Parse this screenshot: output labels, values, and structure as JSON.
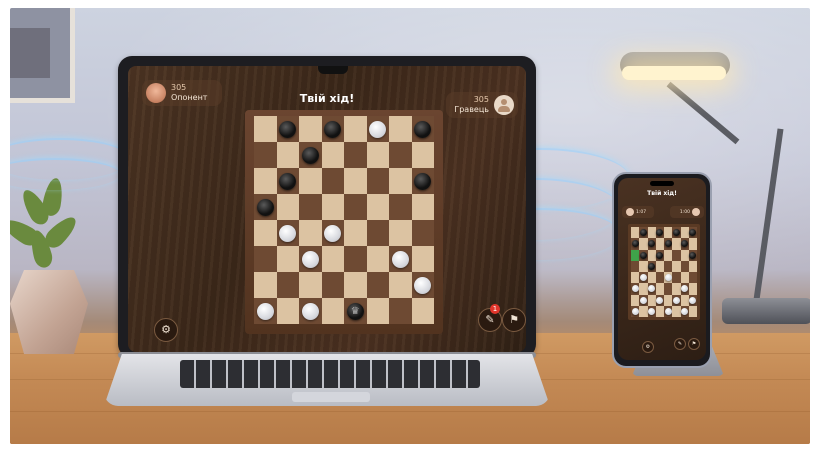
{
  "scene": {
    "description_free": true
  },
  "laptop_game": {
    "turn_title": "Твій хід!",
    "opponent": {
      "score": "305",
      "name": "Опонент"
    },
    "player": {
      "score": "305",
      "name": "Гравець"
    },
    "notification_badge": "1",
    "board": [
      [
        null,
        "b",
        null,
        "b",
        null,
        "w",
        null,
        "b"
      ],
      [
        null,
        null,
        "b",
        null,
        null,
        null,
        null,
        null
      ],
      [
        null,
        "b",
        null,
        null,
        null,
        null,
        null,
        "b"
      ],
      [
        "b",
        null,
        null,
        null,
        null,
        null,
        null,
        null
      ],
      [
        null,
        "w",
        null,
        "w",
        null,
        null,
        null,
        null
      ],
      [
        null,
        null,
        "w",
        null,
        null,
        null,
        "w",
        null
      ],
      [
        null,
        null,
        null,
        null,
        null,
        null,
        null,
        "w"
      ],
      [
        "w",
        null,
        "w",
        null,
        "bk",
        null,
        null,
        null
      ]
    ],
    "icons": {
      "settings": "gear-icon",
      "draw": "pencil-icon",
      "resign": "flag-icon"
    }
  },
  "phone_game": {
    "turn_title": "Твій хід!",
    "opponent_score": "1:07",
    "player_score": "1:00",
    "board": [
      [
        null,
        "b",
        null,
        "b",
        null,
        "b",
        null,
        "b"
      ],
      [
        "b",
        null,
        "b",
        null,
        "b",
        null,
        "b",
        null
      ],
      [
        "h",
        "b",
        null,
        "b",
        null,
        null,
        null,
        "b"
      ],
      [
        null,
        null,
        "b",
        null,
        null,
        null,
        null,
        null
      ],
      [
        null,
        "w",
        null,
        null,
        "w",
        null,
        null,
        null
      ],
      [
        "w",
        null,
        "w",
        null,
        null,
        null,
        "w",
        null
      ],
      [
        null,
        "w",
        null,
        "w",
        null,
        "w",
        null,
        "w"
      ],
      [
        "w",
        null,
        "w",
        null,
        "w",
        null,
        "w",
        null
      ]
    ]
  }
}
